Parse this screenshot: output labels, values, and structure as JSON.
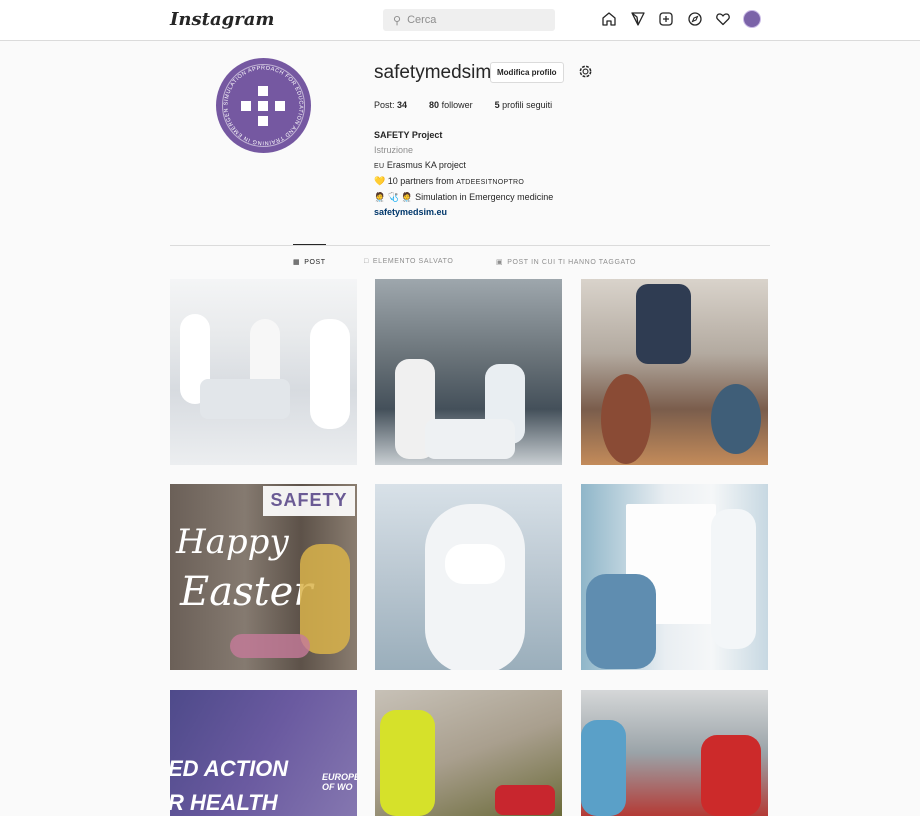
{
  "app": {
    "logo_text": "Instagram",
    "search_placeholder": "Cerca",
    "nav_icons": [
      "home-icon",
      "direct-icon",
      "new-post-icon",
      "explore-icon",
      "activity-heart-icon",
      "profile-avatar-icon"
    ]
  },
  "profile": {
    "username": "safetymedsim",
    "edit_button": "Modifica profilo",
    "stats": {
      "posts_label": "Post:",
      "posts_value": "34",
      "followers_value": "80",
      "followers_label": "follower",
      "following_value": "5",
      "following_label": "profili seguiti"
    },
    "bio": {
      "name": "SAFETY Project",
      "category": "Istruzione",
      "line1_flag": "EU",
      "line1_text": "Erasmus KA project",
      "line2_emoji": "💛",
      "line2_text": "10 partners from",
      "line2_code": "ATDEESITNOPTRO",
      "line3_emoji": "🧑‍⚕️ 🩺 🧑‍⚕️",
      "line3_text": "Simulation in Emergency medicine",
      "link": "safetymedsim.eu"
    },
    "avatar_ring_text": "SIMULATION APPROACH FOR EDUCATION AND TRAINING IN EMERGENCY"
  },
  "tabs": [
    {
      "label": "POST",
      "icon": "grid-icon",
      "active": true
    },
    {
      "label": "ELEMENTO SALVATO",
      "icon": "bookmark-icon",
      "active": false
    },
    {
      "label": "POST IN CUI TI HANNO TAGGATO",
      "icon": "tagged-icon",
      "active": false
    }
  ],
  "posts": {
    "easter_text_1": "Happy",
    "easter_text_2": "Easter",
    "safety_logo": "SAFETY",
    "banner_line1": "ED ACTION",
    "banner_line2": "R HEALTH",
    "banner_small_1": "EUROPE",
    "banner_small_2": "OF WO"
  },
  "colors": {
    "brand_purple": "#7558a1",
    "link": "#00376b",
    "muted": "#8e8e8e"
  }
}
